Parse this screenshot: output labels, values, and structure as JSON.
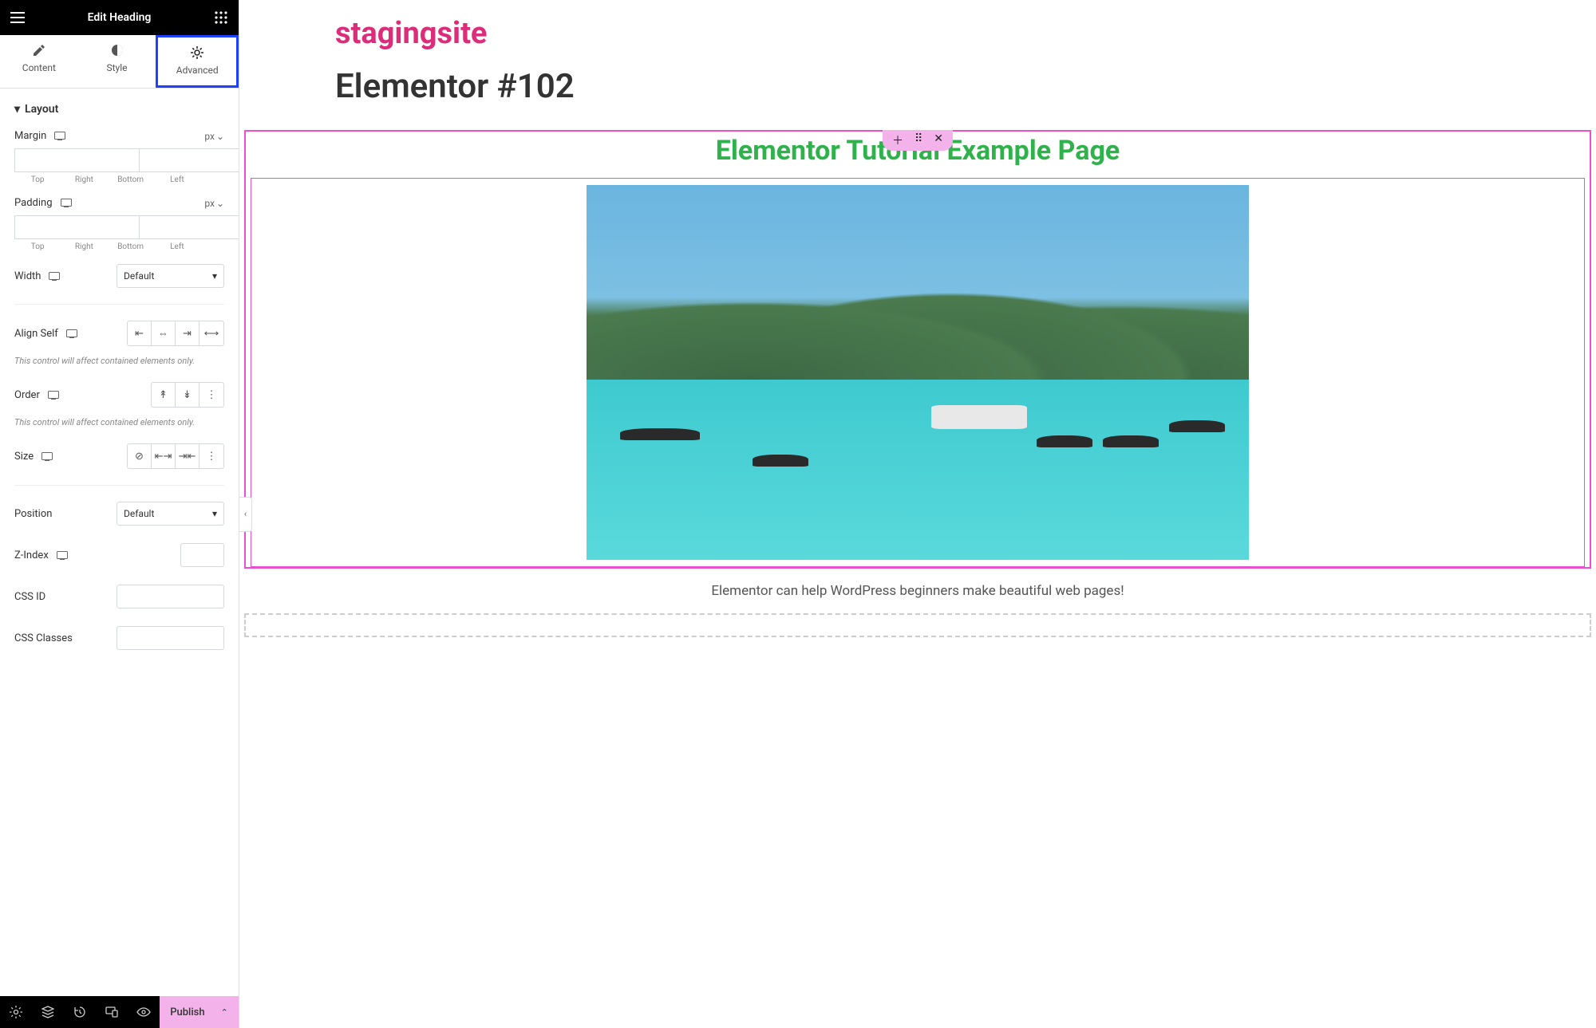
{
  "header": {
    "title": "Edit Heading"
  },
  "tabs": {
    "content": "Content",
    "style": "Style",
    "advanced": "Advanced",
    "active": "advanced"
  },
  "layout": {
    "section_label": "Layout",
    "margin_label": "Margin",
    "padding_label": "Padding",
    "unit": "px",
    "dim_labels": {
      "top": "Top",
      "right": "Right",
      "bottom": "Bottom",
      "left": "Left"
    },
    "width_label": "Width",
    "width_value": "Default",
    "align_self_label": "Align Self",
    "order_label": "Order",
    "size_label": "Size",
    "hint_contained": "This control will affect contained elements only.",
    "position_label": "Position",
    "position_value": "Default",
    "zindex_label": "Z-Index",
    "cssid_label": "CSS ID",
    "cssclasses_label": "CSS Classes"
  },
  "bottom": {
    "publish": "Publish"
  },
  "canvas": {
    "site_title": "stagingsite",
    "page_title": "Elementor #102",
    "heading_text": "Elementor Tutorial Example Page",
    "caption": "Elementor can help WordPress beginners make beautiful web pages!"
  }
}
